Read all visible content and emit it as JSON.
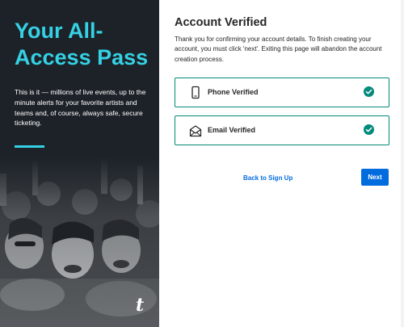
{
  "promo": {
    "title": "Your All-Access Pass",
    "body": "This is it — millions of live events, up to the minute alerts for your favorite artists and teams and, of course, always safe, secure ticketing.",
    "brand_mark": "t"
  },
  "card": {
    "title": "Account Verified",
    "description": "Thank you for confirming your account details. To finish creating your account, you must click 'next'. Exiting this page will abandon the account creation process.",
    "rows": [
      {
        "label": "Phone Verified",
        "icon": "phone-icon",
        "status_icon": "check-circle-icon"
      },
      {
        "label": "Email Verified",
        "icon": "envelope-icon",
        "status_icon": "check-circle-icon"
      }
    ],
    "back_label": "Back to Sign Up",
    "next_label": "Next"
  },
  "colors": {
    "accent": "#35d1e4",
    "promo_bg": "#1d2228",
    "verified": "#028a7b",
    "primary_button": "#026cdf",
    "link": "#026cdf"
  }
}
